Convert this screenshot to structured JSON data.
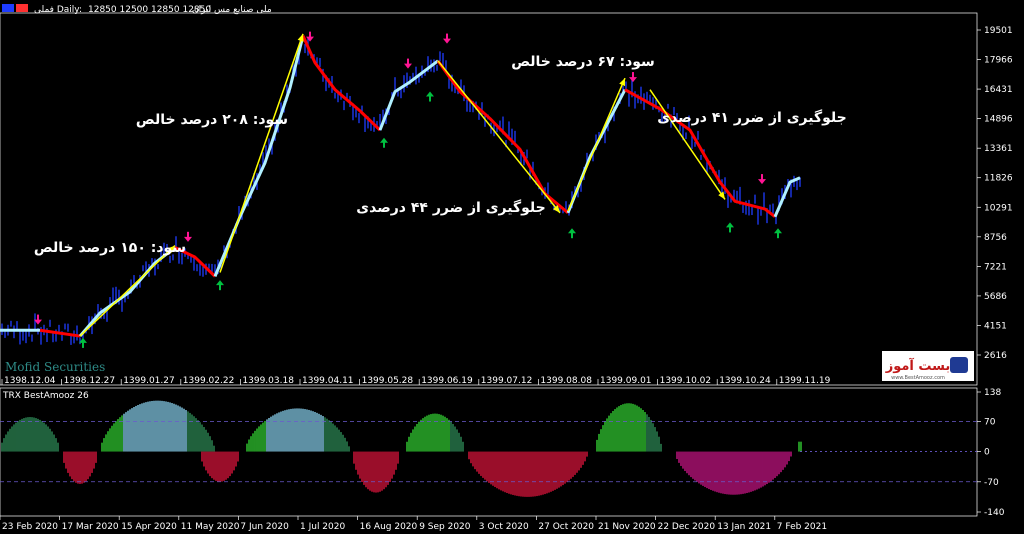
{
  "header": {
    "symbol": "ملی صنایع مس ایران",
    "timeframe": "فملی Daily:",
    "ohlc": "12850 12500 12850 12850"
  },
  "watermark": {
    "broker": "Mofid Securities",
    "logo_text": "بست آموز",
    "logo_url": "www.BestAmooz.com"
  },
  "main_y_ticks": [
    "19501",
    "17966",
    "16431",
    "14896",
    "13361",
    "11826",
    "10291",
    "8756",
    "7221",
    "5686",
    "4151",
    "2616"
  ],
  "main_x_ticks": [
    "1398.12.04",
    "1398.12.27",
    "1399.01.27",
    "1399.02.22",
    "1399.03.18",
    "1399.04.11",
    "1399.05.28",
    "1399.06.19",
    "1399.07.12",
    "1399.08.08",
    "1399.09.01",
    "1399.10.02",
    "1399.10.24",
    "1399.11.19"
  ],
  "annotations": [
    {
      "text": "سود: ۱۵۰ درصد خالص"
    },
    {
      "text": "سود: ۲۰۸ درصد خالص"
    },
    {
      "text": "سود: ۶۷ درصد خالص"
    },
    {
      "text": "جلوگیری از ضرر ۴۴ درصدی"
    },
    {
      "text": "جلوگیری از ضرر ۴۱ درصدی"
    }
  ],
  "indicator": {
    "name": "TRX BestAmooz 26",
    "y_ticks": [
      "138",
      "70",
      "0",
      "-70",
      "-140"
    ],
    "x_ticks": [
      "23 Feb 2020",
      "17 Mar 2020",
      "15 Apr 2020",
      "11 May 2020",
      "7 Jun 2020",
      "1 Jul 2020",
      "16 Aug 2020",
      "9 Sep 2020",
      "3 Oct 2020",
      "27 Oct 2020",
      "21 Nov 2020",
      "22 Dec 2020",
      "13 Jan 2021",
      "7 Feb 2021"
    ],
    "levels": [
      70,
      -70
    ]
  },
  "colors": {
    "up_trail": "#b0f0ff",
    "down_trail": "#ff0000",
    "candle": "#1e3cff",
    "buy_arrow": "#00c040",
    "sell_arrow": "#ff1493",
    "arrow_line": "#ffff00",
    "hist_pos_bright": "#32cd32",
    "hist_pos_mid": "#87ceeb",
    "hist_pos_dark": "#2e8b57",
    "hist_neg": "#dc143c",
    "hist_neg_alt": "#c71585"
  },
  "chart_data": [
    {
      "type": "line",
      "title": "فملی Daily",
      "ylim": [
        2616,
        19501
      ],
      "trail_segments": [
        {
          "dir": "up",
          "points": [
            [
              0,
              3900
            ],
            [
              40,
              3900
            ]
          ]
        },
        {
          "dir": "down",
          "points": [
            [
              40,
              3900
            ],
            [
              80,
              3600
            ]
          ]
        },
        {
          "dir": "up",
          "points": [
            [
              80,
              3600
            ],
            [
              100,
              4800
            ],
            [
              130,
              5900
            ],
            [
              155,
              7400
            ],
            [
              175,
              8200
            ]
          ]
        },
        {
          "dir": "down",
          "points": [
            [
              175,
              8200
            ],
            [
              195,
              7700
            ],
            [
              215,
              6700
            ]
          ]
        },
        {
          "dir": "up",
          "points": [
            [
              215,
              6700
            ],
            [
              240,
              9800
            ],
            [
              265,
              12600
            ],
            [
              290,
              16500
            ],
            [
              303,
              19200
            ]
          ]
        },
        {
          "dir": "down",
          "points": [
            [
              303,
              19200
            ],
            [
              315,
              17800
            ],
            [
              335,
              16400
            ],
            [
              360,
              15300
            ],
            [
              380,
              14300
            ]
          ]
        },
        {
          "dir": "up",
          "points": [
            [
              380,
              14300
            ],
            [
              395,
              16300
            ],
            [
              410,
              16800
            ],
            [
              438,
              17900
            ]
          ]
        },
        {
          "dir": "down",
          "points": [
            [
              438,
              17900
            ],
            [
              460,
              16300
            ],
            [
              490,
              14900
            ],
            [
              520,
              13300
            ],
            [
              545,
              11000
            ],
            [
              568,
              10000
            ]
          ]
        },
        {
          "dir": "up",
          "points": [
            [
              568,
              10000
            ],
            [
              590,
              12900
            ],
            [
              610,
              14900
            ],
            [
              625,
              16400
            ]
          ]
        },
        {
          "dir": "down",
          "points": [
            [
              625,
              16400
            ],
            [
              660,
              15400
            ],
            [
              690,
              14300
            ],
            [
              720,
              11600
            ],
            [
              735,
              10600
            ],
            [
              765,
              10200
            ],
            [
              775,
              9800
            ]
          ]
        },
        {
          "dir": "up",
          "points": [
            [
              775,
              9800
            ],
            [
              790,
              11600
            ],
            [
              800,
              11826
            ]
          ]
        }
      ],
      "buy_signals": [
        [
          83,
          3400
        ],
        [
          220,
          6400
        ],
        [
          384,
          13800
        ],
        [
          430,
          16200
        ],
        [
          572,
          9100
        ],
        [
          730,
          9400
        ],
        [
          778,
          9100
        ]
      ],
      "sell_signals": [
        [
          38,
          4300
        ],
        [
          188,
          8600
        ],
        [
          310,
          19000
        ],
        [
          408,
          17600
        ],
        [
          447,
          18900
        ],
        [
          633,
          16900
        ],
        [
          762,
          11600
        ]
      ],
      "trend_arrows": [
        [
          [
            80,
            3600
          ],
          [
            175,
            8300
          ]
        ],
        [
          [
            220,
            6900
          ],
          [
            303,
            19300
          ]
        ],
        [
          [
            438,
            17900
          ],
          [
            560,
            10000
          ]
        ],
        [
          [
            568,
            10100
          ],
          [
            625,
            17000
          ]
        ],
        [
          [
            650,
            16400
          ],
          [
            725,
            10700
          ]
        ]
      ]
    },
    {
      "type": "bar",
      "title": "TRX BestAmooz 26",
      "ylim": [
        -140,
        138
      ],
      "histogram": [
        {
          "from": 0,
          "to": 60,
          "peak": 80,
          "color": "hist_pos_dark"
        },
        {
          "from": 62,
          "to": 98,
          "peak": -75,
          "color": "hist_neg"
        },
        {
          "from": 100,
          "to": 215,
          "peak": 118,
          "color": "hist_pos_mid"
        },
        {
          "from": 200,
          "to": 240,
          "peak": -70,
          "color": "hist_neg"
        },
        {
          "from": 245,
          "to": 350,
          "peak": 100,
          "color": "hist_pos_mid"
        },
        {
          "from": 352,
          "to": 400,
          "peak": -95,
          "color": "hist_neg"
        },
        {
          "from": 405,
          "to": 465,
          "peak": 88,
          "color": "hist_pos_bright"
        },
        {
          "from": 467,
          "to": 588,
          "peak": -105,
          "color": "hist_neg"
        },
        {
          "from": 595,
          "to": 662,
          "peak": 112,
          "color": "hist_pos_bright"
        },
        {
          "from": 675,
          "to": 792,
          "peak": -100,
          "color": "hist_neg_alt"
        },
        {
          "from": 797,
          "to": 803,
          "peak": 25,
          "color": "hist_pos_bright"
        }
      ]
    }
  ]
}
